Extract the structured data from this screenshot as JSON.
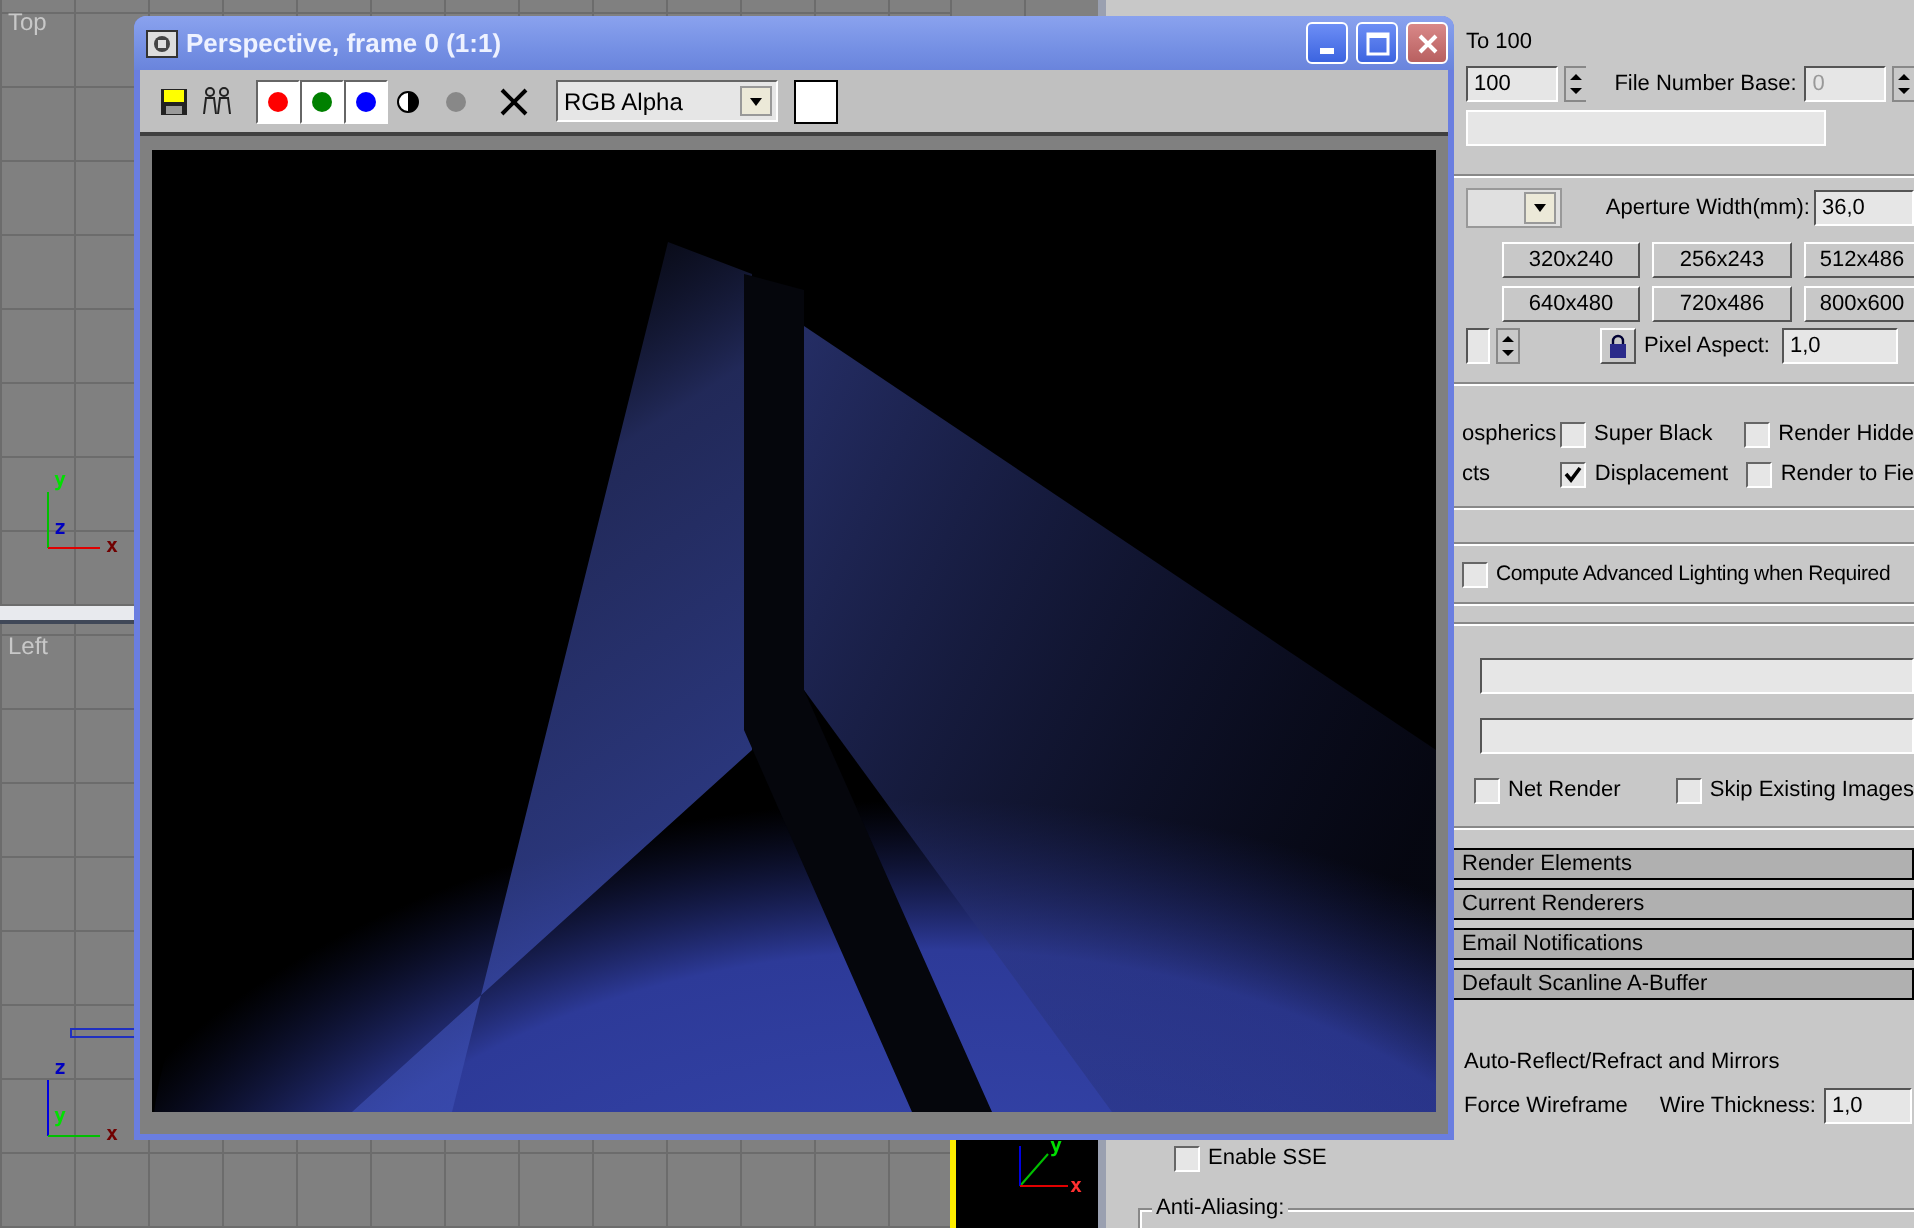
{
  "viewports": [
    {
      "label": "Top",
      "axes": [
        "y",
        "z",
        "x"
      ]
    },
    {
      "label": "Left",
      "axes": [
        "z",
        "y",
        "x"
      ]
    }
  ],
  "perspective_axes": [
    "y",
    "x"
  ],
  "render_window": {
    "title": "Perspective, frame 0 (1:1)",
    "channels": [
      {
        "color": "#ff0000",
        "on": true
      },
      {
        "color": "#008000",
        "on": true
      },
      {
        "color": "#0000ff",
        "on": true
      }
    ],
    "channel_select": "RGB Alpha"
  },
  "render_setup": {
    "range_to": "To 100",
    "range_end": "100",
    "file_number_base_label": "File Number Base:",
    "file_number_base": "0",
    "aperture_label": "Aperture Width(mm):",
    "aperture": "36,0",
    "presets": [
      "320x240",
      "256x243",
      "512x486",
      "640x480",
      "720x486",
      "800x600"
    ],
    "pixel_aspect_label": "Pixel Aspect:",
    "pixel_aspect": "1,0",
    "option_rows": [
      {
        "cut_label": "ospherics",
        "checks": [
          {
            "label": "Super Black",
            "checked": false
          },
          {
            "label": "Render Hidde",
            "checked": false
          }
        ]
      },
      {
        "cut_label": "cts",
        "checks": [
          {
            "label": "Displacement",
            "checked": true
          },
          {
            "label": "Render to Fie",
            "checked": false
          }
        ]
      }
    ],
    "advanced_lighting": {
      "label": "Compute Advanced Lighting when Required",
      "checked": false
    },
    "net_render": {
      "label": "Net Render",
      "checked": false
    },
    "skip_existing": {
      "label": "Skip Existing Images",
      "checked": false
    },
    "rollouts": [
      "Render Elements",
      "Current Renderers",
      "Email Notifications",
      "Default Scanline A-Buffer"
    ],
    "auto_reflect": "Auto-Reflect/Refract and Mirrors",
    "force_wireframe": "Force Wireframe",
    "wire_thickness_label": "Wire Thickness:",
    "wire_thickness": "1,0",
    "enable_sse": {
      "label": "Enable SSE",
      "checked": false
    },
    "anti_aliasing": "Anti-Aliasing:"
  }
}
